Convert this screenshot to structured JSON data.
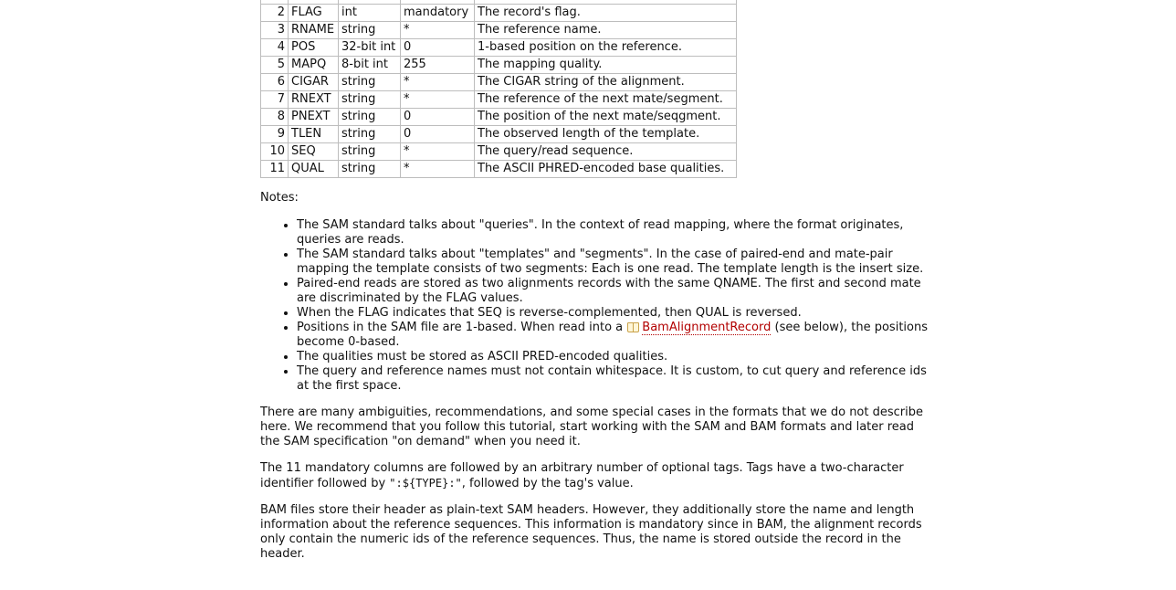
{
  "table": {
    "rows": [
      {
        "num": "",
        "name": "",
        "type": "",
        "default": "",
        "desc": ""
      },
      {
        "num": "2",
        "name": "FLAG",
        "type": "int",
        "default": "mandatory",
        "desc": "The record's flag."
      },
      {
        "num": "3",
        "name": "RNAME",
        "type": "string",
        "default": "*",
        "desc": "The reference name."
      },
      {
        "num": "4",
        "name": "POS",
        "type": "32-bit int",
        "default": "0",
        "desc": "1-based position on the reference."
      },
      {
        "num": "5",
        "name": "MAPQ",
        "type": "8-bit int",
        "default": "255",
        "desc": "The mapping quality."
      },
      {
        "num": "6",
        "name": "CIGAR",
        "type": "string",
        "default": "*",
        "desc": "The CIGAR string of the alignment."
      },
      {
        "num": "7",
        "name": "RNEXT",
        "type": "string",
        "default": "*",
        "desc": "The reference of the next mate/segment."
      },
      {
        "num": "8",
        "name": "PNEXT",
        "type": "string",
        "default": "0",
        "desc": "The position of the next mate/seqgment."
      },
      {
        "num": "9",
        "name": "TLEN",
        "type": "string",
        "default": "0",
        "desc": "The observed length of the template."
      },
      {
        "num": "10",
        "name": "SEQ",
        "type": "string",
        "default": "*",
        "desc": "The query/read sequence."
      },
      {
        "num": "11",
        "name": "QUAL",
        "type": "string",
        "default": "*",
        "desc": "The ASCII PHRED-encoded base qualities."
      }
    ]
  },
  "notes_label": "Notes:",
  "notes": {
    "n1": "The SAM standard talks about \"queries\". In the context of read mapping, where the format originates, queries are reads.",
    "n2": "The SAM standard talks about \"templates\" and \"segments\". In the case of paired-end and mate-pair mapping the template consists of two segments: Each is one read. The template length is the insert size.",
    "n3": "Paired-end reads are stored as two alignments records with the same QNAME. The first and second mate are discriminated by the FLAG values.",
    "n4": "When the FLAG indicates that SEQ is reverse-complemented, then QUAL is reversed.",
    "n5_before": "Positions in the SAM file are 1-based. When read into a",
    "n5_link": "BamAlignmentRecord",
    "n5_after": "(see below), the positions become 0-based.",
    "n6": "The qualities must be stored as ASCII PRED-encoded qualities.",
    "n7": "The query and reference names must not contain whitespace. It is custom, to cut query and reference ids at the first space."
  },
  "paragraphs": {
    "p1": "There are many ambiguities, recommendations, and some special cases in the formats that we do not describe here. We recommend that you follow this tutorial, start working with the SAM and BAM formats and later read the SAM specification \"on demand\" when you need it.",
    "p2_before": "The 11 mandatory columns are followed by an arbitrary number of optional tags. Tags have a two-character identifier followed by",
    "p2_code": "\":${TYPE}:\"",
    "p2_after": ", followed by the tag's value.",
    "p3": "BAM files store their header as plain-text SAM headers. However, they additionally store the name and length information about the reference sequences. This information is mandatory since in BAM, the alignment records only contain the numeric ids of the reference sequences. Thus, the name is stored outside the record in the header."
  },
  "colors": {
    "link": "#b20000",
    "border": "#bdbdbd"
  }
}
